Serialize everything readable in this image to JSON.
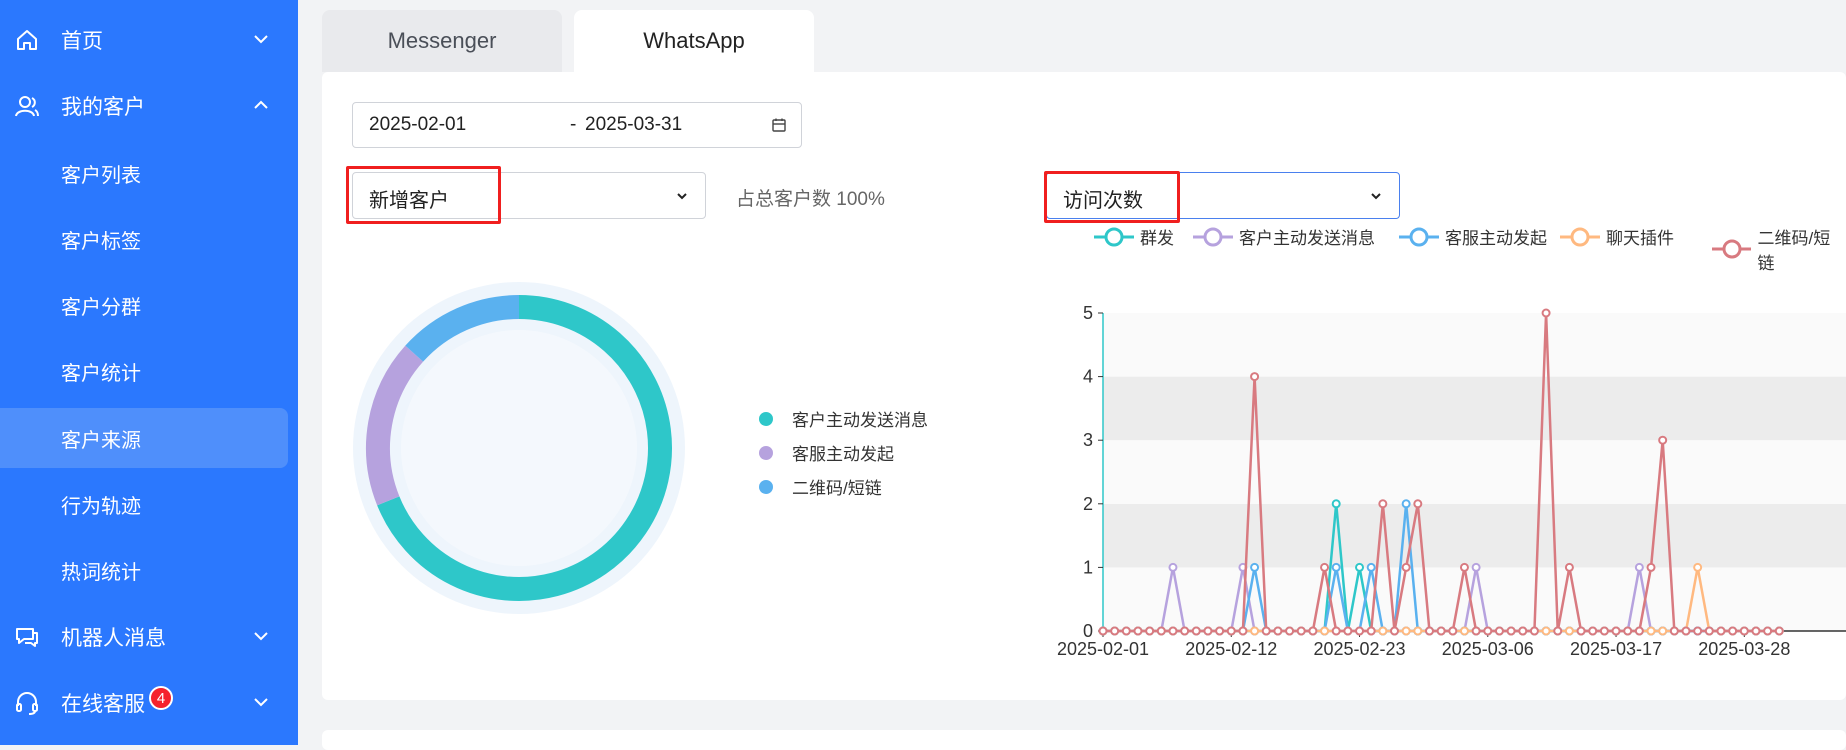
{
  "sidebar": {
    "items": [
      {
        "label": "首页",
        "icon": "home-icon",
        "type": "top",
        "chevron": "down"
      },
      {
        "label": "我的客户",
        "icon": "user-icon",
        "type": "top",
        "chevron": "up"
      },
      {
        "label": "客户列表",
        "type": "sub"
      },
      {
        "label": "客户标签",
        "type": "sub"
      },
      {
        "label": "客户分群",
        "type": "sub"
      },
      {
        "label": "客户统计",
        "type": "sub"
      },
      {
        "label": "客户来源",
        "type": "sub",
        "active": true
      },
      {
        "label": "行为轨迹",
        "type": "sub"
      },
      {
        "label": "热词统计",
        "type": "sub"
      },
      {
        "label": "机器人消息",
        "icon": "chat-icon",
        "type": "top",
        "chevron": "down"
      },
      {
        "label": "在线客服",
        "icon": "headset-icon",
        "type": "top",
        "chevron": "down",
        "badge": "4"
      }
    ]
  },
  "tabs": [
    {
      "label": "Messenger"
    },
    {
      "label": "WhatsApp",
      "active": true
    }
  ],
  "date_range": {
    "start": "2025-02-01",
    "separator": "-",
    "end": "2025-03-31",
    "icon": "calendar-icon"
  },
  "left_select": {
    "value": "新增客户"
  },
  "share_text": "占总客户数 100%",
  "right_select": {
    "value": "访问次数"
  },
  "colors": {
    "sidebar": "#2b78fe",
    "teal": "#2ec7c9",
    "purple": "#b6a2de",
    "blue": "#5ab1ef",
    "orange": "#ffb980",
    "red": "#d87a80"
  },
  "donut": {
    "legend": [
      {
        "label": "客户主动发送消息",
        "color": "#2ec7c9",
        "value": 62
      },
      {
        "label": "客服主动发起",
        "color": "#b6a2de",
        "value": 16
      },
      {
        "label": "二维码/短链",
        "color": "#5ab1ef",
        "value": 12
      }
    ]
  },
  "chart_data": {
    "type": "line",
    "x_start": "2025-02-01",
    "x_ticks": [
      "2025-02-01",
      "2025-02-12",
      "2025-02-23",
      "2025-03-06",
      "2025-03-17",
      "2025-03-28"
    ],
    "ylim": [
      0,
      5
    ],
    "y_ticks": [
      "0",
      "1",
      "2",
      "3",
      "4",
      "5"
    ],
    "series": [
      {
        "name": "群发",
        "color": "#2ec7c9",
        "points": [
          [
            20,
            2
          ],
          [
            21,
            0
          ],
          [
            22,
            1
          ]
        ]
      },
      {
        "name": "客户主动发送消息",
        "color": "#b6a2de",
        "points": [
          [
            6,
            1
          ],
          [
            12,
            1
          ],
          [
            32,
            1
          ],
          [
            46,
            1
          ]
        ]
      },
      {
        "name": "客服主动发起",
        "color": "#5ab1ef",
        "points": [
          [
            13,
            1
          ],
          [
            20,
            1
          ],
          [
            23,
            1
          ],
          [
            26,
            2
          ]
        ]
      },
      {
        "name": "聊天插件",
        "color": "#ffb980",
        "points": [
          [
            51,
            1
          ]
        ]
      },
      {
        "name": "二维码/短链",
        "color": "#d87a80",
        "points": [
          [
            13,
            4
          ],
          [
            18,
            0
          ],
          [
            19,
            1
          ],
          [
            24,
            2
          ],
          [
            26,
            1
          ],
          [
            27,
            2
          ],
          [
            31,
            1
          ],
          [
            38,
            5
          ],
          [
            40,
            1
          ],
          [
            47,
            1
          ],
          [
            48,
            3
          ]
        ]
      }
    ],
    "n_days": 59
  }
}
